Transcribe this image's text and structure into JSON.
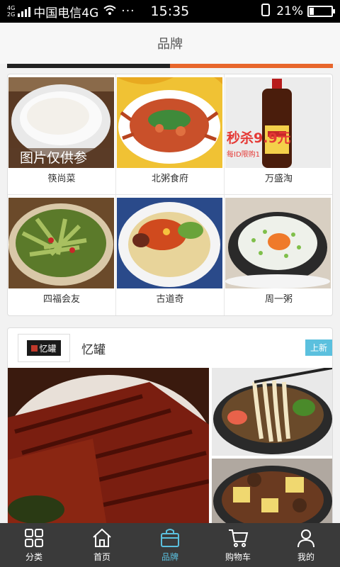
{
  "status_bar": {
    "network_top": "4G",
    "network_bottom": "2G",
    "carrier": "中国电信4G",
    "dots": "···",
    "time": "15:35",
    "battery_level": 0.21,
    "battery_text": "21%"
  },
  "header": {
    "title": "品牌"
  },
  "brands": [
    {
      "name": "筷尚菜",
      "image": "rice bowl",
      "overlay_text": "图片仅供参"
    },
    {
      "name": "北粥食府",
      "image": "crab dish"
    },
    {
      "name": "万盛淘",
      "image": "soy sauce bottle",
      "overlay_text": "秒杀9.9元",
      "overlay_subtext": "每ID限购1"
    },
    {
      "name": "四福会友",
      "image": "cucumber salad"
    },
    {
      "name": "古道奇",
      "image": "noodles with sauce"
    },
    {
      "name": "周一粥",
      "image": "congee bowl"
    }
  ],
  "featured": {
    "logo_text": "忆罐",
    "title": "忆罐",
    "badge": "上新",
    "images": [
      "braised pork",
      "noodle soup",
      "stew pot"
    ]
  },
  "tabbar": {
    "active": 2,
    "items": [
      {
        "label": "分类",
        "icon": "grid-icon"
      },
      {
        "label": "首页",
        "icon": "home-icon"
      },
      {
        "label": "品牌",
        "icon": "bag-icon"
      },
      {
        "label": "购物车",
        "icon": "cart-icon"
      },
      {
        "label": "我的",
        "icon": "user-icon"
      }
    ]
  },
  "colors": {
    "accent": "#5bc0de",
    "tabbar_bg": "#3a3a3a",
    "header_bg": "#f7f7f7"
  }
}
